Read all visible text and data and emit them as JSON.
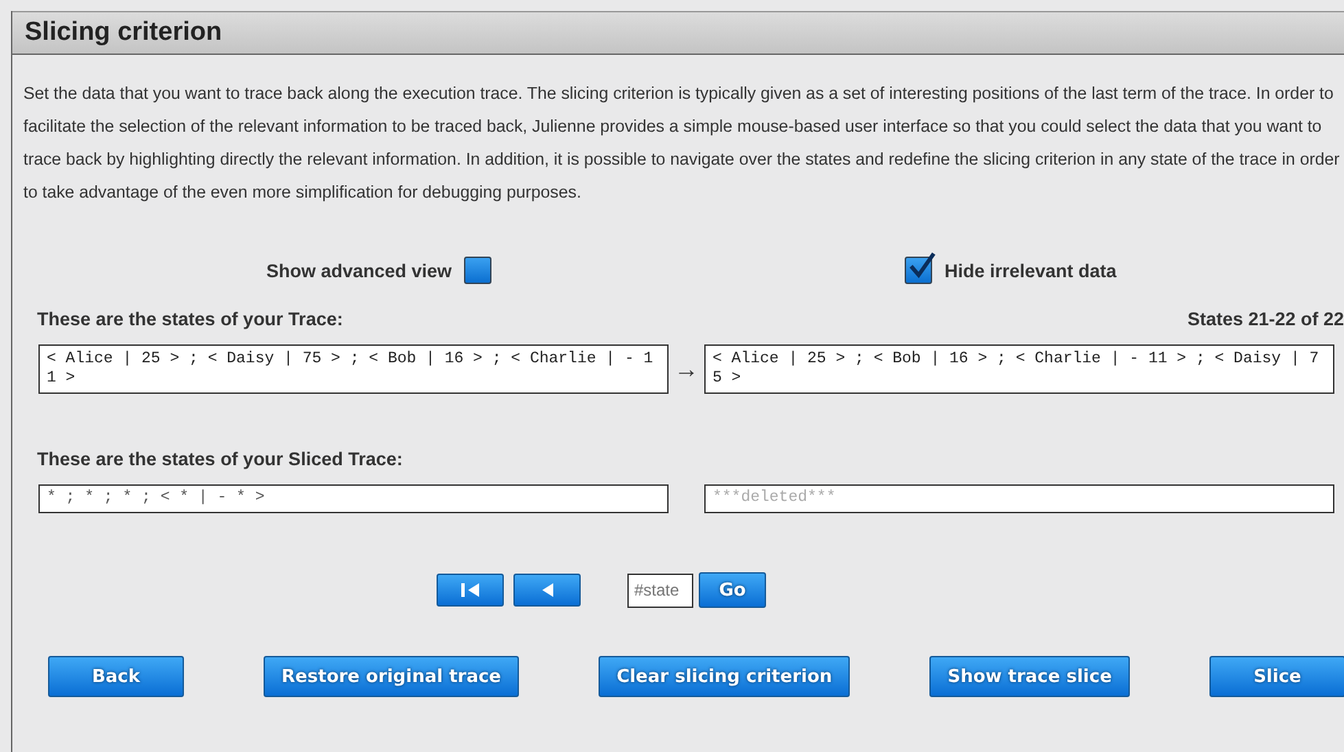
{
  "panel": {
    "title": "Slicing criterion"
  },
  "description": "Set the data that you want to trace back along the execution trace. The slicing criterion is typically given as a set of interesting positions of the last term of the trace. In order to facilitate the selection of the relevant information to be traced back, Julienne provides a simple mouse-based user interface so that you could select the data that you want to trace back by highlighting directly the relevant information. In addition, it is possible to navigate over the states and redefine the slicing criterion in any state of the trace in order to take advantage of the even more simplification for debugging purposes.",
  "options": [
    {
      "label": "Show advanced view",
      "checked": false
    },
    {
      "label": "Hide irrelevant data",
      "checked": true
    }
  ],
  "trace": {
    "heading": "These are the states of your Trace:",
    "range": "States 21-22 of 22",
    "states": [
      "< Alice | 25 > ; < Daisy | 75 > ; < Bob | 16 > ; < Charlie | - 11 >",
      "< Alice | 25 > ; < Bob | 16 > ; < Charlie | - 11 > ; < Daisy | 75 >"
    ],
    "arrow": "→"
  },
  "sliced": {
    "heading": "These are the states of your Sliced Trace:",
    "states": [
      {
        "text": "* ; * ; * ; < * | - * >",
        "deleted": false
      },
      {
        "text": "***deleted***",
        "deleted": true
      }
    ]
  },
  "navigation": {
    "state_placeholder": "#state",
    "go": "Go"
  },
  "actions": [
    "Back",
    "Restore original trace",
    "Clear slicing criterion",
    "Show trace slice",
    "Slice"
  ]
}
